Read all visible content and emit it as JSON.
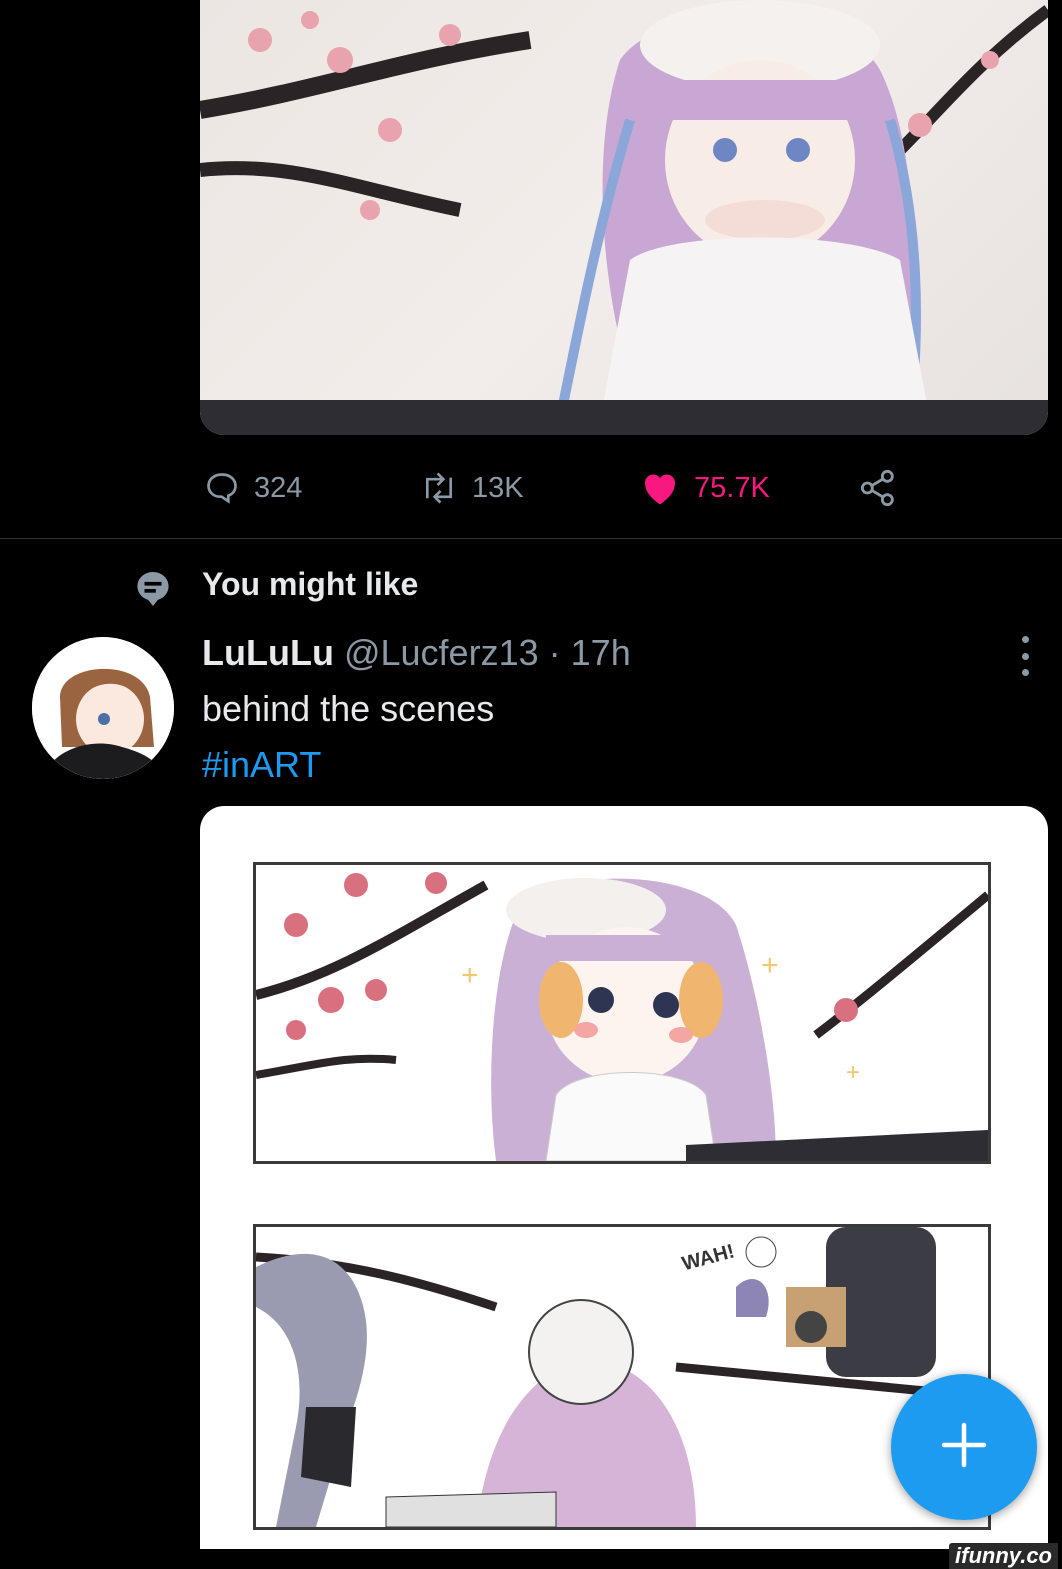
{
  "top_post": {
    "stats": {
      "replies": "324",
      "retweets": "13K",
      "likes": "75.7K"
    }
  },
  "you_might_like": {
    "label": "You might like"
  },
  "post": {
    "author_name": "LuLuLu",
    "handle": "@Lucferz13",
    "separator": "·",
    "time": "17h",
    "text": "behind the scenes",
    "hashtag": "#inART",
    "comic_sfx": "WAH!"
  },
  "watermark": "ifunny.co",
  "colors": {
    "background": "#000000",
    "like": "#f91880",
    "accent": "#1d9bf0",
    "muted": "#8b98a5"
  },
  "icons": [
    "reply-icon",
    "retweet-icon",
    "heart-icon",
    "share-icon",
    "suggestion-icon",
    "more-icon",
    "compose-plus-icon"
  ]
}
